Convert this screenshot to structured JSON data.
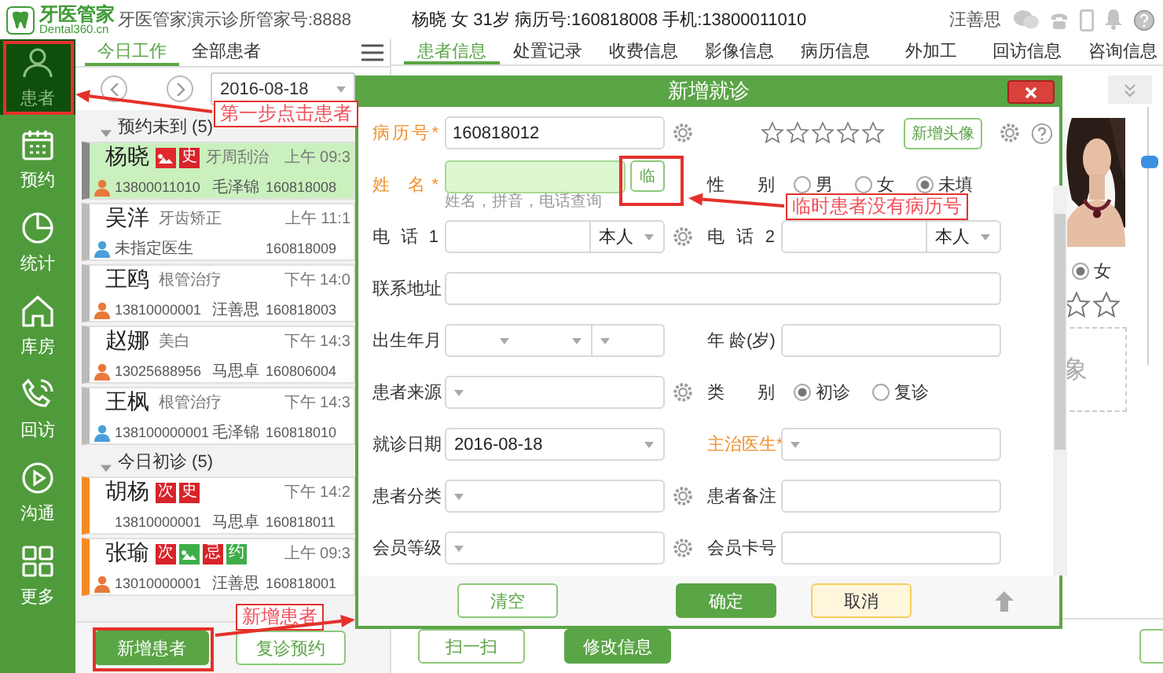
{
  "header": {
    "logo_title": "牙医管家",
    "logo_subtitle": "Dental360.cn",
    "clinic": "牙医管家演示诊所",
    "account": "管家号:8888",
    "patient_summary": "杨晓 女 31岁 病历号:160818008 手机:13800011010",
    "user": "汪善思"
  },
  "sidebar": {
    "items": [
      {
        "label": "患者",
        "selected": true
      },
      {
        "label": "预约",
        "selected": false
      },
      {
        "label": "统计",
        "selected": false
      },
      {
        "label": "库房",
        "selected": false
      },
      {
        "label": "回访",
        "selected": false
      },
      {
        "label": "沟通",
        "selected": false
      },
      {
        "label": "更多",
        "selected": false
      }
    ]
  },
  "patient_list": {
    "tabs": [
      {
        "label": "今日工作",
        "selected": true
      },
      {
        "label": "全部患者",
        "selected": false
      }
    ],
    "date": "2016-08-18",
    "groups": [
      {
        "title": "预约未到 (5)",
        "kind": "appointment",
        "expanded": true,
        "patients": [
          {
            "name": "杨晓",
            "selected": true,
            "tags": [
              {
                "kind": "icon",
                "color": "#e0282e"
              },
              {
                "kind": "text",
                "text": "史",
                "color": "#d8232a"
              }
            ],
            "treatment": "牙周刮治",
            "time": "上午 09:3",
            "color": "#e8793a",
            "phone": "13800011010",
            "doctor": "毛泽锦",
            "record": "160818008"
          },
          {
            "name": "吴洋",
            "selected": false,
            "treatment": "牙齿矫正",
            "time": "上午 11:1",
            "color": "#4a9fd8",
            "doctor": "未指定医生",
            "record": "160818009"
          },
          {
            "name": "王鸥",
            "selected": false,
            "treatment": "根管治疗",
            "time": "下午 14:0",
            "color": "#e8793a",
            "phone": "13810000001",
            "doctor": "汪善思",
            "record": "160818003"
          },
          {
            "name": "赵娜",
            "selected": false,
            "treatment": "美白",
            "time": "下午 14:3",
            "color": "#e8793a",
            "phone": "13025688956",
            "doctor": "马思卓",
            "record": "160806004"
          },
          {
            "name": "王枫",
            "selected": false,
            "treatment": "根管治疗",
            "time": "下午 14:3",
            "color": "#4a9fd8",
            "phone": "138100000001",
            "doctor": "毛泽锦",
            "record": "160818010"
          }
        ]
      },
      {
        "title": "今日初诊 (5)",
        "kind": "first_visit",
        "expanded": true,
        "patients": [
          {
            "name": "胡杨",
            "selected": false,
            "tags": [
              {
                "kind": "text",
                "text": "次",
                "color": "#d8232a"
              },
              {
                "kind": "text",
                "text": "史",
                "color": "#d8232a"
              }
            ],
            "time": "下午 14:2",
            "phone": "13810000001",
            "doctor": "马思卓",
            "record": "160818011"
          },
          {
            "name": "张瑜",
            "selected": false,
            "tags": [
              {
                "kind": "text",
                "text": "次",
                "color": "#d8232a"
              },
              {
                "kind": "icon",
                "color": "#3fae49"
              },
              {
                "kind": "text",
                "text": "忌",
                "color": "#d8232a"
              },
              {
                "kind": "text",
                "text": "约",
                "color": "#3fae49"
              }
            ],
            "time": "上午 09:3",
            "color": "#e8793a",
            "phone": "13010000001",
            "doctor": "汪善思",
            "record": "160818001"
          }
        ]
      }
    ],
    "buttons": [
      {
        "label": "新增患者",
        "kind": "primary"
      },
      {
        "label": "复诊预约",
        "kind": "outline"
      }
    ]
  },
  "main": {
    "tabs": [
      {
        "label": "患者信息",
        "selected": true
      },
      {
        "label": "处置记录",
        "selected": false
      },
      {
        "label": "收费信息",
        "selected": false
      },
      {
        "label": "影像信息",
        "selected": false
      },
      {
        "label": "病历信息",
        "selected": false
      },
      {
        "label": "外加工",
        "selected": false
      },
      {
        "label": "回访信息",
        "selected": false
      },
      {
        "label": "咨询信息",
        "selected": false
      }
    ],
    "profile": {
      "gender_options": [
        {
          "label": "女",
          "selected": true
        }
      ],
      "image_box_text": "象",
      "zoom_slider": {
        "level": 0.8
      }
    },
    "buttons": [
      {
        "label": "扫一扫",
        "kind": "outline"
      },
      {
        "label": "修改信息",
        "kind": "primary"
      },
      {
        "kind": "outline"
      }
    ]
  },
  "dialog": {
    "title": "新增就诊",
    "rows": [
      {
        "left": {
          "label": "病历号*",
          "required": true,
          "kind": "input",
          "value": "160818012",
          "gear": true
        },
        "extra": {
          "stars": 0,
          "button": "新增头像"
        }
      },
      {
        "left": {
          "label": "姓 名*",
          "required": true,
          "kind": "input",
          "highlight": true,
          "button": "临",
          "hint": "姓名，拼音，电话查询"
        },
        "right": {
          "label": "性 别",
          "kind": "radio",
          "options": [
            {
              "label": "男",
              "selected": false
            },
            {
              "label": "女",
              "selected": false
            },
            {
              "label": "未填",
              "selected": true
            }
          ]
        }
      },
      {
        "left": {
          "label": "电 话 1",
          "kind": "input",
          "addon": "本人",
          "gear": true
        },
        "right": {
          "label": "电 话 2",
          "kind": "input",
          "addon": "本人"
        }
      },
      {
        "left": {
          "label": "联系地址",
          "kind": "input",
          "wide": true
        }
      },
      {
        "left": {
          "label": "出生年月",
          "kind": "date3"
        },
        "right": {
          "label": "年 龄(岁)",
          "kind": "input"
        }
      },
      {
        "left": {
          "label": "患者来源",
          "kind": "select",
          "gear": true
        },
        "right": {
          "label": "类 别",
          "kind": "radio",
          "options": [
            {
              "label": "初诊",
              "selected": true
            },
            {
              "label": "复诊",
              "selected": false
            }
          ]
        }
      },
      {
        "left": {
          "label": "就诊日期",
          "kind": "select",
          "value": "2016-08-18"
        },
        "right": {
          "label": "主治医生*",
          "required": true,
          "kind": "select"
        }
      },
      {
        "left": {
          "label": "患者分类",
          "kind": "select",
          "gear": true
        },
        "right": {
          "label": "患者备注",
          "kind": "input"
        }
      },
      {
        "left": {
          "label": "会员等级",
          "kind": "select",
          "gear": true
        },
        "right": {
          "label": "会员卡号",
          "kind": "input"
        }
      }
    ],
    "buttons": [
      {
        "label": "清空",
        "kind": "outline"
      },
      {
        "label": "确定",
        "kind": "primary"
      },
      {
        "label": "取消",
        "kind": "warning"
      }
    ]
  },
  "annotations": [
    {
      "text": "第一步点击患者"
    },
    {
      "text": "临时患者没有病历号"
    },
    {
      "text": "新增患者"
    }
  ]
}
